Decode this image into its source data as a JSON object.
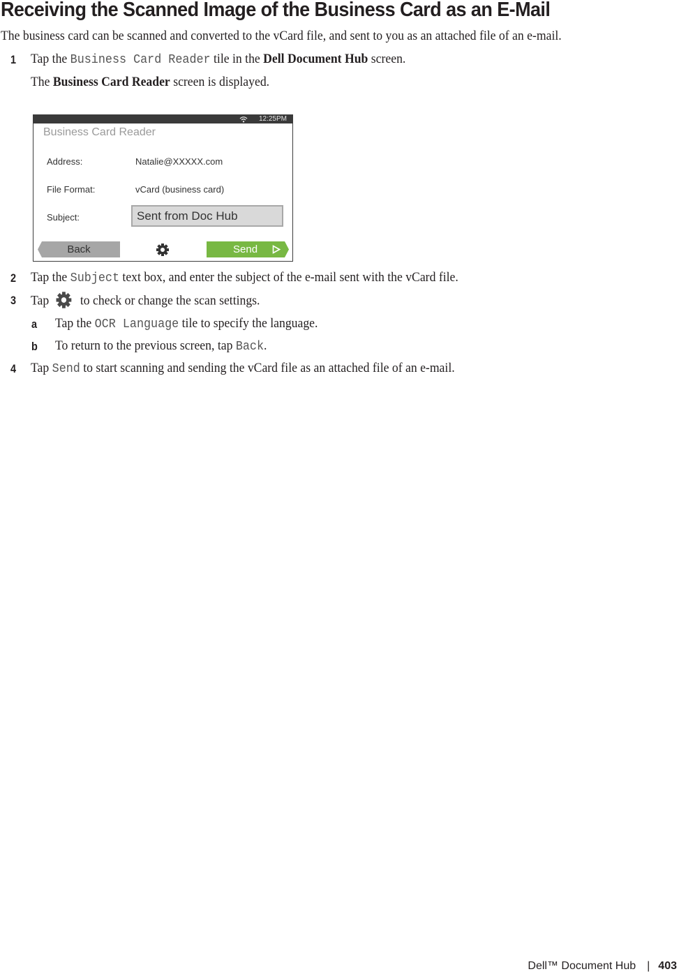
{
  "heading": "Receiving the Scanned Image of the Business Card as an E-Mail",
  "intro": "The business card can be scanned and converted to the vCard file, and sent to you as an attached file of an e-mail.",
  "steps": [
    {
      "num": "1",
      "pre": "Tap the ",
      "code": "Business Card Reader",
      "mid": " tile in the ",
      "bold": "Dell Document Hub",
      "post": " screen.",
      "result_pre": "The ",
      "result_bold": "Business Card Reader",
      "result_post": " screen is displayed."
    },
    {
      "num": "2",
      "pre": "Tap the ",
      "code": "Subject",
      "post": " text box, and enter the subject of the e-mail sent with the vCard file."
    },
    {
      "num": "3",
      "pre": "Tap",
      "icon": "gear-icon",
      "post": "to check or change the scan settings.",
      "substeps": [
        {
          "letter": "a",
          "pre": "Tap the ",
          "code": "OCR Language",
          "post": " tile to specify the language."
        },
        {
          "letter": "b",
          "pre": "To return to the previous screen, tap ",
          "code": "Back",
          "post": "."
        }
      ]
    },
    {
      "num": "4",
      "pre": "Tap ",
      "code": "Send",
      "post": " to start scanning and sending the vCard file as an attached file of an e-mail."
    }
  ],
  "screen": {
    "time": "12:25PM",
    "wifi_icon": "wifi-icon",
    "title": "Business Card Reader",
    "rows": [
      {
        "label": "Address:",
        "value": "Natalie@XXXXX.com"
      },
      {
        "label": "File Format:",
        "value": "vCard (business card)"
      },
      {
        "label": "Subject:",
        "value": "Sent from Doc Hub"
      }
    ],
    "back_label": "Back",
    "settings_icon": "gear-icon",
    "send_label": "Send",
    "colors": {
      "statusbar": "#3a3a3a",
      "send": "#78b843",
      "back": "#a6a6a6",
      "subject_box": "#d9d9d9"
    }
  },
  "footer": {
    "product": "Dell™ Document Hub",
    "separator": "|",
    "page": "403"
  }
}
